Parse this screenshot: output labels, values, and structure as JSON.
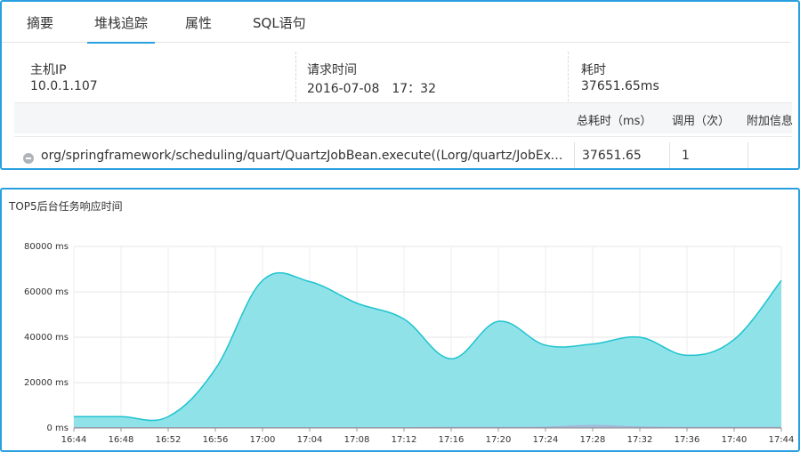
{
  "tabs": [
    {
      "label": "摘要"
    },
    {
      "label": "堆栈追踪"
    },
    {
      "label": "属性"
    },
    {
      "label": "SQL语句"
    }
  ],
  "info": {
    "host_label": "主机IP",
    "host_value": "10.0.1.107",
    "time_label": "请求时间",
    "time_value": "2016-07-08　17：32",
    "duration_label": "耗时",
    "duration_value": "37651.65ms"
  },
  "table": {
    "headers": {
      "total_time": "总耗时（ms）",
      "calls": "调用（次）",
      "extra": "附加信息"
    },
    "rows": [
      {
        "method": "org/springframework/scheduling/quart/QuartzJobBean.execute((Lorg/quartz/JobExecutionContext;)V",
        "total_time": "37651.65",
        "calls": "1",
        "extra": ""
      }
    ]
  },
  "colors": {
    "accent": "#2a9fe0",
    "area_fill": "#8fe3e8",
    "area_line": "#1fc3cf",
    "secondary_series": "#a7b1d8"
  },
  "chart_data": {
    "type": "area",
    "title": "TOP5后台任务响应时间",
    "x": [
      "16:44",
      "16:48",
      "16:52",
      "16:56",
      "17:00",
      "17:04",
      "17:08",
      "17:12",
      "17:16",
      "17:20",
      "17:24",
      "17:28",
      "17:32",
      "17:36",
      "17:40",
      "17:44"
    ],
    "y_tick_labels": [
      "80000 ms",
      "60000 ms",
      "40000 ms",
      "20000 ms",
      "0 ms"
    ],
    "ylim": [
      0,
      80000
    ],
    "grid": true,
    "series": [
      {
        "values": [
          5000,
          5000,
          5000,
          26000,
          65000,
          64500,
          55000,
          48000,
          30500,
          47000,
          36500,
          37000,
          40000,
          32000,
          39000,
          65000
        ]
      },
      {
        "values": [
          200,
          200,
          200,
          200,
          200,
          200,
          200,
          200,
          300,
          300,
          400,
          1200,
          500,
          300,
          300,
          300
        ]
      }
    ]
  }
}
